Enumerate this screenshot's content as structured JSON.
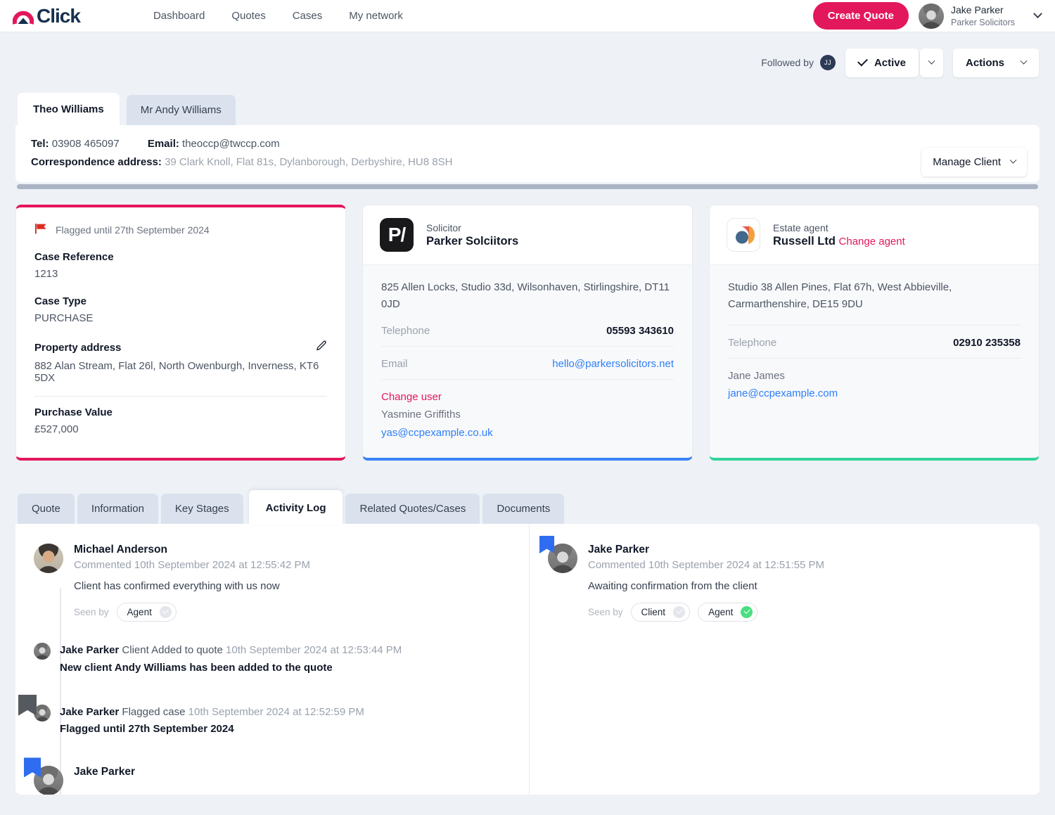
{
  "brand": {
    "name": "Click",
    "accent": "#e3175c",
    "navy": "#16304f"
  },
  "nav": {
    "items": [
      {
        "label": "Dashboard"
      },
      {
        "label": "Quotes"
      },
      {
        "label": "Cases"
      },
      {
        "label": "My network"
      }
    ],
    "create_quote": "Create Quote",
    "user": {
      "name": "Jake Parker",
      "org": "Parker Solicitors"
    }
  },
  "statusbar": {
    "followed_by_label": "Followed by",
    "follower_initials": "JJ",
    "active_label": "Active",
    "actions_label": "Actions"
  },
  "client": {
    "tabs": [
      {
        "label": "Theo Williams",
        "active": true
      },
      {
        "label": "Mr Andy Williams",
        "active": false
      }
    ],
    "tel_label": "Tel:",
    "tel_value": "03908 465097",
    "email_label": "Email:",
    "email_value": "theoccp@twccp.com",
    "address_label": "Correspondence address:",
    "address_value": "39 Clark Knoll, Flat 81s, Dylanborough, Derbyshire, HU8 8SH",
    "manage_button": "Manage Client"
  },
  "case_card": {
    "flag_text": "Flagged until 27th September 2024",
    "reference_label": "Case Reference",
    "reference_value": "1213",
    "type_label": "Case Type",
    "type_value": "PURCHASE",
    "property_label": "Property address",
    "property_value": "882 Alan Stream, Flat 26l, North Owenburgh, Inverness, KT6 5DX",
    "value_label": "Purchase Value",
    "value_value": "£527,000",
    "accent": "#e3175c"
  },
  "solicitor_card": {
    "kicker": "Solicitor",
    "name": "Parker Solciitors",
    "logo_text": "P/",
    "address": "825 Allen Locks, Studio 33d, Wilsonhaven, Stirlingshire, DT11 0JD",
    "telephone_label": "Telephone",
    "telephone_value": "05593 343610",
    "email_label": "Email",
    "email_value": "hello@parkersolicitors.net",
    "change_user": "Change user",
    "contact_name": "Yasmine Griffiths",
    "contact_email": "yas@ccpexample.co.uk",
    "accent": "#3b82f6"
  },
  "agent_card": {
    "kicker": "Estate agent",
    "name": "Russell Ltd",
    "change_agent": "Change agent",
    "address": "Studio 38 Allen Pines, Flat 67h, West Abbieville, Carmarthenshire, DE15 9DU",
    "telephone_label": "Telephone",
    "telephone_value": "02910 235358",
    "contact_name": "Jane James",
    "contact_email": "jane@ccpexample.com",
    "accent": "#34d399"
  },
  "bottom_tabs": [
    {
      "label": "Quote",
      "active": false
    },
    {
      "label": "Information",
      "active": false
    },
    {
      "label": "Key Stages",
      "active": false
    },
    {
      "label": "Activity Log",
      "active": true
    },
    {
      "label": "Related Quotes/Cases",
      "active": false
    },
    {
      "label": "Documents",
      "active": false
    }
  ],
  "activity": {
    "seen_by_label": "Seen by",
    "left": {
      "comment": {
        "author": "Michael Anderson",
        "meta": "Commented 10th September 2024 at 12:55:42 PM",
        "text": "Client has confirmed everything with us now",
        "badges": [
          {
            "label": "Agent",
            "seen": false
          }
        ]
      },
      "events": [
        {
          "author": "Jake Parker",
          "action": "Client Added to quote",
          "timestamp": "10th September 2024 at 12:53:44 PM",
          "detail": "New client Andy Williams has been added to the quote",
          "marker": "none"
        },
        {
          "author": "Jake Parker",
          "action": "Flagged case",
          "timestamp": "10th September 2024 at 12:52:59 PM",
          "detail": "Flagged until 27th September 2024",
          "marker": "gray"
        },
        {
          "author": "Jake Parker",
          "action": "",
          "timestamp": "",
          "detail": "",
          "marker": "blue"
        }
      ]
    },
    "right": {
      "comment": {
        "author": "Jake Parker",
        "meta": "Commented 10th September 2024 at 12:51:55 PM",
        "text": "Awaiting confirmation from the client",
        "badges": [
          {
            "label": "Client",
            "seen": false
          },
          {
            "label": "Agent",
            "seen": true
          }
        ]
      }
    }
  }
}
